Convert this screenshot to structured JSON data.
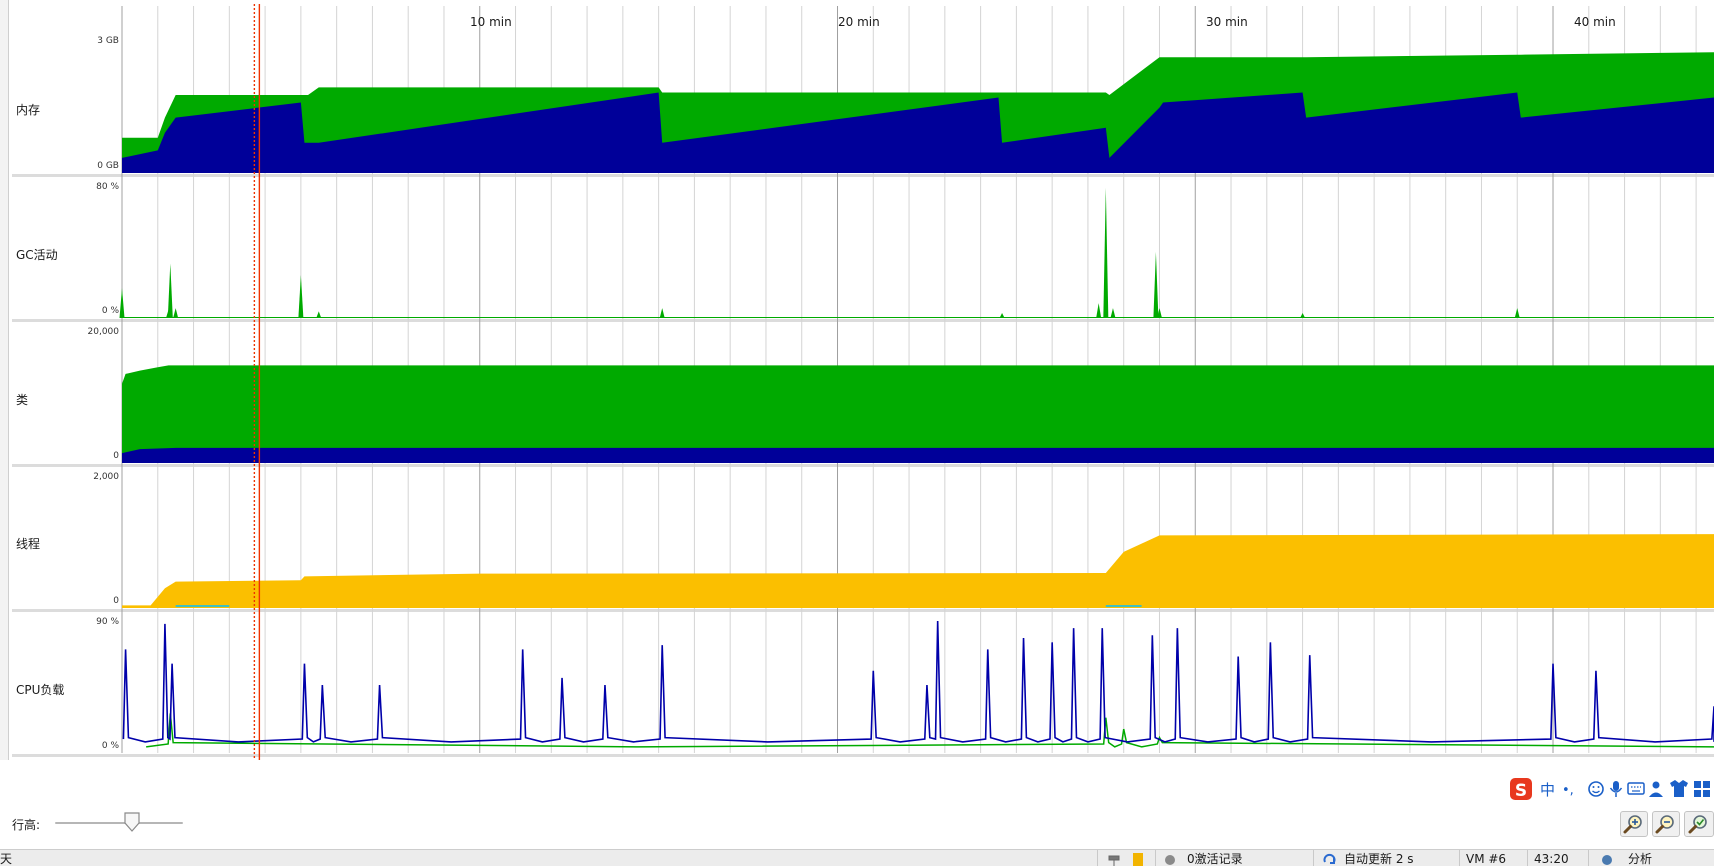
{
  "timeline": {
    "time_labels": [
      "10 min",
      "20 min",
      "30 min",
      "40 min"
    ]
  },
  "panels": [
    {
      "label": "内存",
      "axis_max": "3 GB",
      "axis_min": "0 GB"
    },
    {
      "label": "GC活动",
      "axis_max": "80 %",
      "axis_min": "0 %"
    },
    {
      "label": "类",
      "axis_max": "20,000",
      "axis_min": "0"
    },
    {
      "label": "线程",
      "axis_max": "2,000",
      "axis_min": "0"
    },
    {
      "label": "CPU负载",
      "axis_max": "90 %",
      "axis_min": "0 %"
    }
  ],
  "colors": {
    "memory_committed": "#00aa00",
    "memory_used": "#000099",
    "classes_loaded": "#00aa00",
    "classes_base": "#000099",
    "threads": "#fbbf00",
    "threads_accent": "#40c0c0",
    "cpu_process": "#0000aa",
    "cpu_gc": "#00aa00",
    "cursor": "#ee3300"
  },
  "controls": {
    "row_height_label": "行高:",
    "row_height_level": 0.6,
    "zoom_in_icon": "zoom-in-icon",
    "zoom_out_icon": "zoom-out-icon",
    "zoom_fit_icon": "zoom-fit-icon"
  },
  "ime": {
    "logo": "S",
    "mode_label": "中",
    "punct_label": "•,"
  },
  "status_bar": {
    "left_text": "天",
    "record_text": "0激活记录",
    "refresh_text": "自动更新 2 s",
    "vm_text": "VM #6",
    "time_text": "43:20",
    "analyze_text": "分析"
  },
  "chart_data": {
    "type": "area",
    "title": "",
    "x_unit": "min",
    "xlim": [
      0,
      44.5
    ],
    "x_ticks": [
      10,
      20,
      30,
      40
    ],
    "grid": true,
    "cursor_x_min": 3.7,
    "series_groups": [
      {
        "panel": "内存",
        "unit": "GB",
        "ylim": [
          0,
          3
        ],
        "series": [
          {
            "id": "committed",
            "x": [
              0,
              1,
              1.2,
              1.5,
              5,
              5.2,
              5.5,
              15,
              15.1,
              24.5,
              24.6,
              27.5,
              27.6,
              29,
              29.1,
              33,
              33.1,
              39,
              39.1,
              44.5
            ],
            "y": [
              0.7,
              0.7,
              1.1,
              1.55,
              1.55,
              1.55,
              1.7,
              1.7,
              1.6,
              1.6,
              1.6,
              1.6,
              1.55,
              2.3,
              2.3,
              2.3,
              2.3,
              2.35,
              2.35,
              2.4
            ]
          },
          {
            "id": "used",
            "x": [
              0,
              1,
              1.2,
              1.5,
              5,
              5.1,
              5.5,
              15,
              15.1,
              24.5,
              24.6,
              27.5,
              27.6,
              29,
              29.1,
              33,
              33.1,
              39,
              39.1,
              44.5
            ],
            "y": [
              0.3,
              0.45,
              0.8,
              1.1,
              1.4,
              0.6,
              0.6,
              1.6,
              0.6,
              1.5,
              0.6,
              0.9,
              0.3,
              1.3,
              1.4,
              1.6,
              1.1,
              1.6,
              1.1,
              1.5
            ]
          }
        ]
      },
      {
        "panel": "GC活动",
        "unit": "%",
        "ylim": [
          0,
          80
        ],
        "spikes": [
          {
            "x": 0,
            "y": 18
          },
          {
            "x": 1.3,
            "y": 5
          },
          {
            "x": 1.35,
            "y": 33
          },
          {
            "x": 1.5,
            "y": 6
          },
          {
            "x": 5.0,
            "y": 26
          },
          {
            "x": 5.5,
            "y": 4
          },
          {
            "x": 15.1,
            "y": 6
          },
          {
            "x": 24.6,
            "y": 3
          },
          {
            "x": 27.3,
            "y": 9
          },
          {
            "x": 27.5,
            "y": 79
          },
          {
            "x": 27.7,
            "y": 6
          },
          {
            "x": 28.9,
            "y": 40
          },
          {
            "x": 29.0,
            "y": 6
          },
          {
            "x": 33.0,
            "y": 3
          },
          {
            "x": 39.0,
            "y": 6
          }
        ]
      },
      {
        "panel": "类",
        "unit": "count",
        "ylim": [
          0,
          20000
        ],
        "series": [
          {
            "id": "loaded",
            "x": [
              0,
              0.1,
              0.5,
              1.0,
              1.3,
              44.5
            ],
            "y": [
              12000,
              13500,
              14000,
              14500,
              14800,
              14800
            ]
          },
          {
            "id": "base",
            "x": [
              0,
              0.5,
              1.5,
              44.5
            ],
            "y": [
              1500,
              2100,
              2300,
              2300
            ]
          }
        ]
      },
      {
        "panel": "线程",
        "unit": "count",
        "ylim": [
          0,
          2000
        ],
        "series": [
          {
            "id": "live",
            "x": [
              0,
              0.8,
              1.2,
              1.5,
              5.0,
              5.1,
              10,
              27.5,
              28.0,
              29.0,
              44.5
            ],
            "y": [
              40,
              40,
              300,
              400,
              420,
              480,
              520,
              530,
              850,
              1100,
              1120
            ]
          }
        ]
      },
      {
        "panel": "CPU负载",
        "unit": "%",
        "ylim": [
          0,
          90
        ],
        "peaks_process": [
          {
            "x": 0.1,
            "y": 70
          },
          {
            "x": 1.2,
            "y": 88
          },
          {
            "x": 1.4,
            "y": 60
          },
          {
            "x": 5.1,
            "y": 60
          },
          {
            "x": 5.6,
            "y": 45
          },
          {
            "x": 7.2,
            "y": 45
          },
          {
            "x": 11.2,
            "y": 70
          },
          {
            "x": 12.3,
            "y": 50
          },
          {
            "x": 13.5,
            "y": 45
          },
          {
            "x": 15.1,
            "y": 73
          },
          {
            "x": 21,
            "y": 55
          },
          {
            "x": 22.5,
            "y": 45
          },
          {
            "x": 22.8,
            "y": 90
          },
          {
            "x": 24.2,
            "y": 70
          },
          {
            "x": 25.2,
            "y": 78
          },
          {
            "x": 26.0,
            "y": 75
          },
          {
            "x": 26.6,
            "y": 85
          },
          {
            "x": 27.4,
            "y": 85
          },
          {
            "x": 28.8,
            "y": 80
          },
          {
            "x": 29.5,
            "y": 85
          },
          {
            "x": 31.2,
            "y": 65
          },
          {
            "x": 32.1,
            "y": 75
          },
          {
            "x": 33.2,
            "y": 66
          },
          {
            "x": 40.0,
            "y": 60
          },
          {
            "x": 41.2,
            "y": 55
          },
          {
            "x": 44.5,
            "y": 30
          }
        ],
        "peaks_gc": [
          {
            "x": 1.35,
            "y": 25
          },
          {
            "x": 27.5,
            "y": 22
          },
          {
            "x": 28.0,
            "y": 14
          },
          {
            "x": 29.0,
            "y": 8
          }
        ]
      }
    ]
  }
}
